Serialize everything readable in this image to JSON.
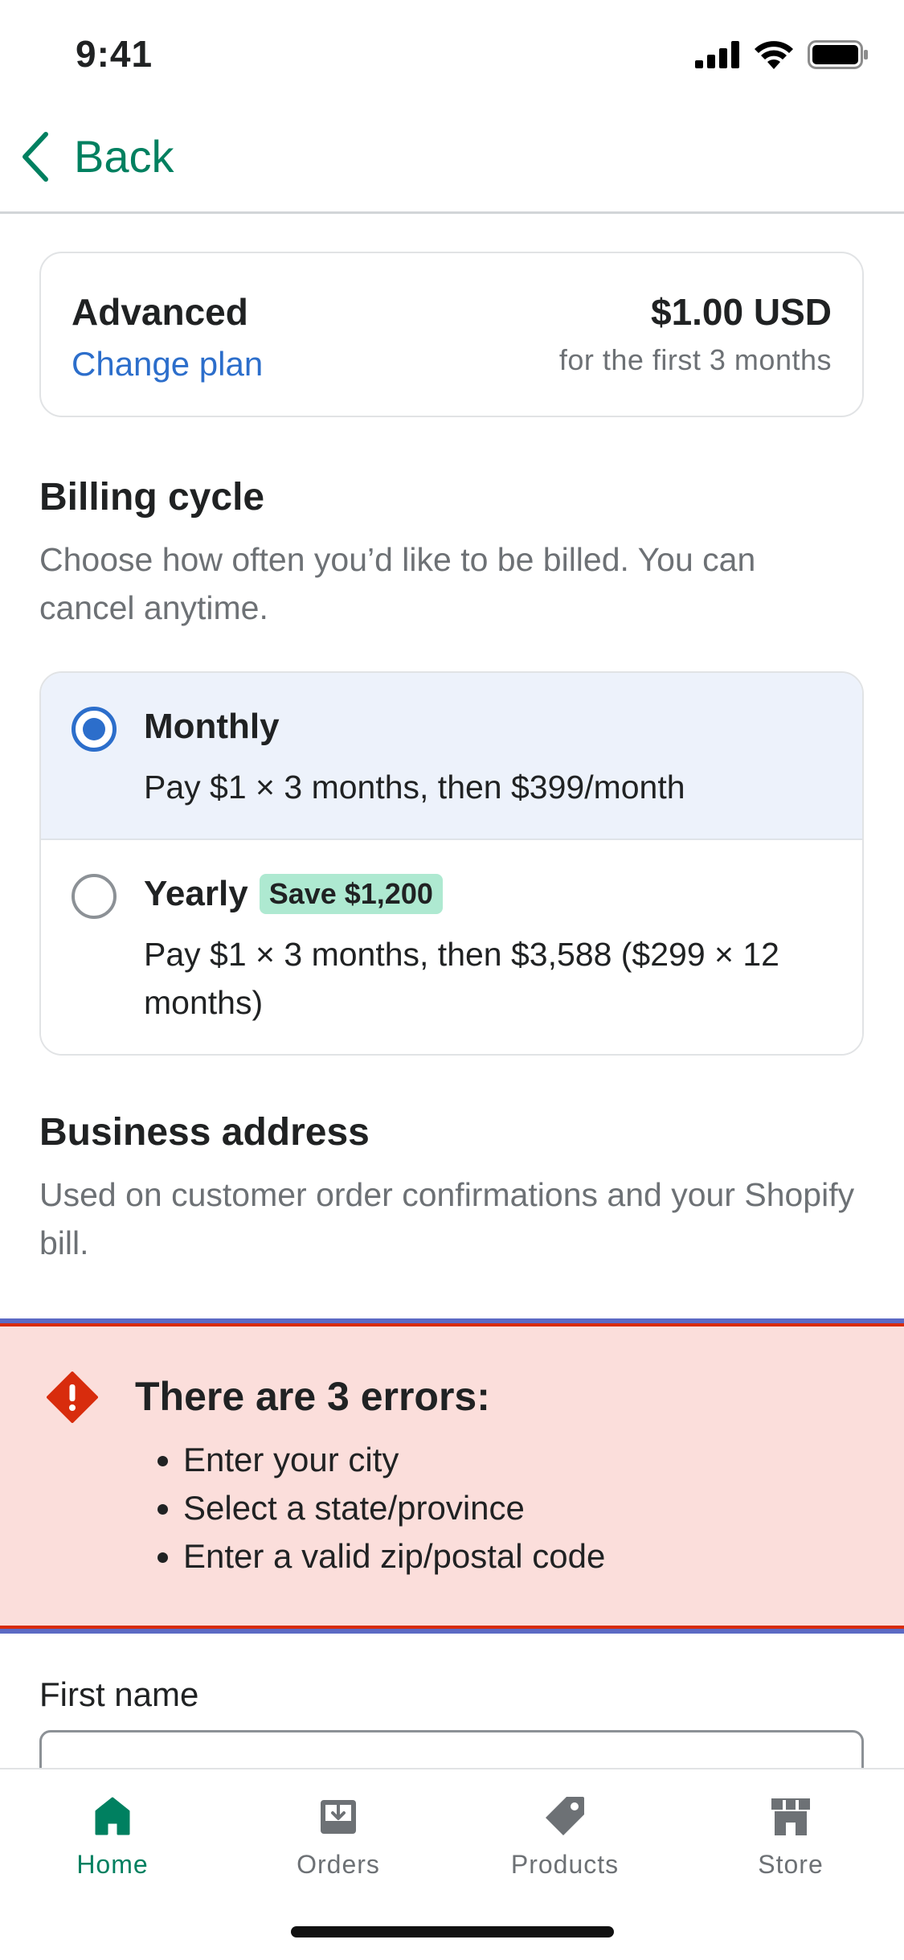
{
  "status_bar": {
    "time": "9:41"
  },
  "nav": {
    "back_label": "Back"
  },
  "plan": {
    "name": "Advanced",
    "change_label": "Change plan",
    "price": "$1.00 USD",
    "price_note": "for the first 3 months"
  },
  "billing": {
    "title": "Billing cycle",
    "description": "Choose how often you’d like to be billed. You can cancel anytime.",
    "options": [
      {
        "label": "Monthly",
        "detail": "Pay $1 × 3 months, then $399/month",
        "selected": true,
        "badge": ""
      },
      {
        "label": "Yearly",
        "detail": "Pay $1 × 3 months, then $3,588 ($299 × 12 months)",
        "selected": false,
        "badge": "Save $1,200"
      }
    ]
  },
  "address": {
    "title": "Business address",
    "description": "Used on customer order confirmations and your Shopify bill."
  },
  "errors": {
    "title": "There are 3 errors:",
    "items": [
      "Enter your city",
      "Select a state/province",
      "Enter a valid zip/postal code"
    ]
  },
  "form": {
    "first_name_label": "First name",
    "first_name_value": ""
  },
  "tabs": [
    {
      "label": "Home",
      "icon": "home-icon",
      "active": true
    },
    {
      "label": "Orders",
      "icon": "orders-icon",
      "active": false
    },
    {
      "label": "Products",
      "icon": "products-icon",
      "active": false
    },
    {
      "label": "Store",
      "icon": "store-icon",
      "active": false
    }
  ],
  "colors": {
    "brand": "#008060",
    "link": "#2c6ecb",
    "critical": "#d82c0d",
    "error_bg": "#fbdedb",
    "selected_bg": "#edf2fb",
    "badge_bg": "#aee9d1"
  }
}
